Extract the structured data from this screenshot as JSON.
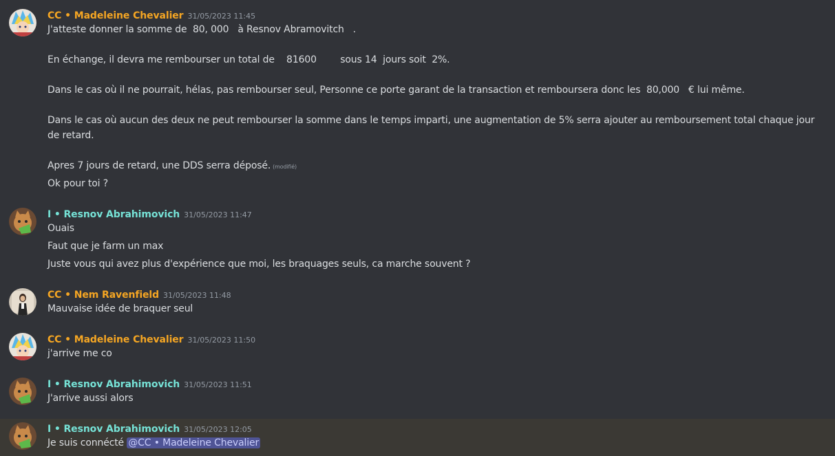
{
  "colors": {
    "background": "#313338",
    "highlight_background": "#3b3934",
    "author_orange": "#f5a623",
    "author_teal": "#76e3d7",
    "text": "#dbdee1",
    "timestamp": "#949ba4",
    "mention_bg": "#4f5496"
  },
  "messages": [
    {
      "author": "CC • Madeleine Chevalier",
      "timestamp": "31/05/2023 11:45",
      "avatar_icon": "anime-avatar-icon",
      "lines": [
        "J'atteste donner la somme de  80, 000   à Resnov Abramovitch   .",
        "En échange, il devra me rembourser un total de    81600        sous 14  jours soit  2%.",
        "Dans le cas où il ne pourrait, hélas, pas rembourser seul, Personne ce porte garant de la transaction et remboursera donc les  80,000   € lui même.",
        "Dans le cas où aucun des deux ne peut rembourser la somme dans le temps imparti, une augmentation de 5% serra ajouter au remboursement total chaque jour",
        "de retard.",
        "Apres 7 jours de retard, une DDS serra déposé.",
        "Ok pour toi ?"
      ],
      "edited_label": "(modifié)"
    },
    {
      "author": "I • Resnov Abrahimovich",
      "timestamp": "31/05/2023 11:47",
      "avatar_icon": "cat-avatar-icon",
      "lines": [
        "Ouais",
        "Faut que je farm un max",
        "Juste vous qui avez plus d'expérience que moi, les braquages seuls, ca marche souvent ?"
      ]
    },
    {
      "author": "CC • Nem Ravenfield",
      "timestamp": "31/05/2023 11:48",
      "avatar_icon": "person-avatar-icon",
      "lines": [
        "Mauvaise idée de braquer seul"
      ]
    },
    {
      "author": "CC • Madeleine Chevalier",
      "timestamp": "31/05/2023 11:50",
      "avatar_icon": "anime-avatar-icon",
      "lines": [
        "j'arrive me co"
      ]
    },
    {
      "author": "I • Resnov Abrahimovich",
      "timestamp": "31/05/2023 11:51",
      "avatar_icon": "cat-avatar-icon",
      "lines": [
        "J'arrive aussi alors"
      ]
    },
    {
      "author": "I • Resnov Abrahimovich",
      "timestamp": "31/05/2023 12:05",
      "avatar_icon": "cat-avatar-icon",
      "lines": [
        "Je suis connécté "
      ],
      "mention": "@CC • Madeleine Chevalier"
    }
  ]
}
